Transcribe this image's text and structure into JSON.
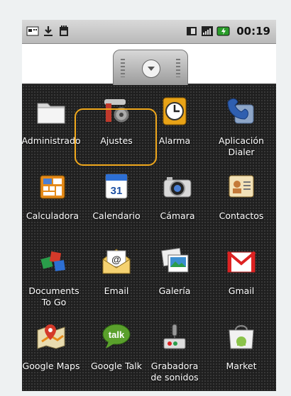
{
  "status_bar": {
    "time": "00:19"
  },
  "apps": [
    {
      "label": "Administrado",
      "icon": "folder-icon"
    },
    {
      "label": "Ajustes",
      "icon": "settings-icon"
    },
    {
      "label": "Alarma",
      "icon": "clock-icon"
    },
    {
      "label": "Aplicación\nDialer",
      "icon": "phone-icon"
    },
    {
      "label": "Calculadora",
      "icon": "calculator-icon"
    },
    {
      "label": "Calendario",
      "icon": "calendar-icon"
    },
    {
      "label": "Cámara",
      "icon": "camera-icon"
    },
    {
      "label": "Contactos",
      "icon": "contacts-icon"
    },
    {
      "label": "Documents\nTo Go",
      "icon": "documents-icon"
    },
    {
      "label": "Email",
      "icon": "email-icon"
    },
    {
      "label": "Galería",
      "icon": "gallery-icon"
    },
    {
      "label": "Gmail",
      "icon": "gmail-icon"
    },
    {
      "label": "Google Maps",
      "icon": "maps-icon"
    },
    {
      "label": "Google Talk",
      "icon": "talk-icon"
    },
    {
      "label": "Grabadora\nde sonidos",
      "icon": "recorder-icon"
    },
    {
      "label": "Market",
      "icon": "market-icon"
    }
  ],
  "calendar_day": "31",
  "talk_text": "talk",
  "highlight_color": "#f0a81c"
}
